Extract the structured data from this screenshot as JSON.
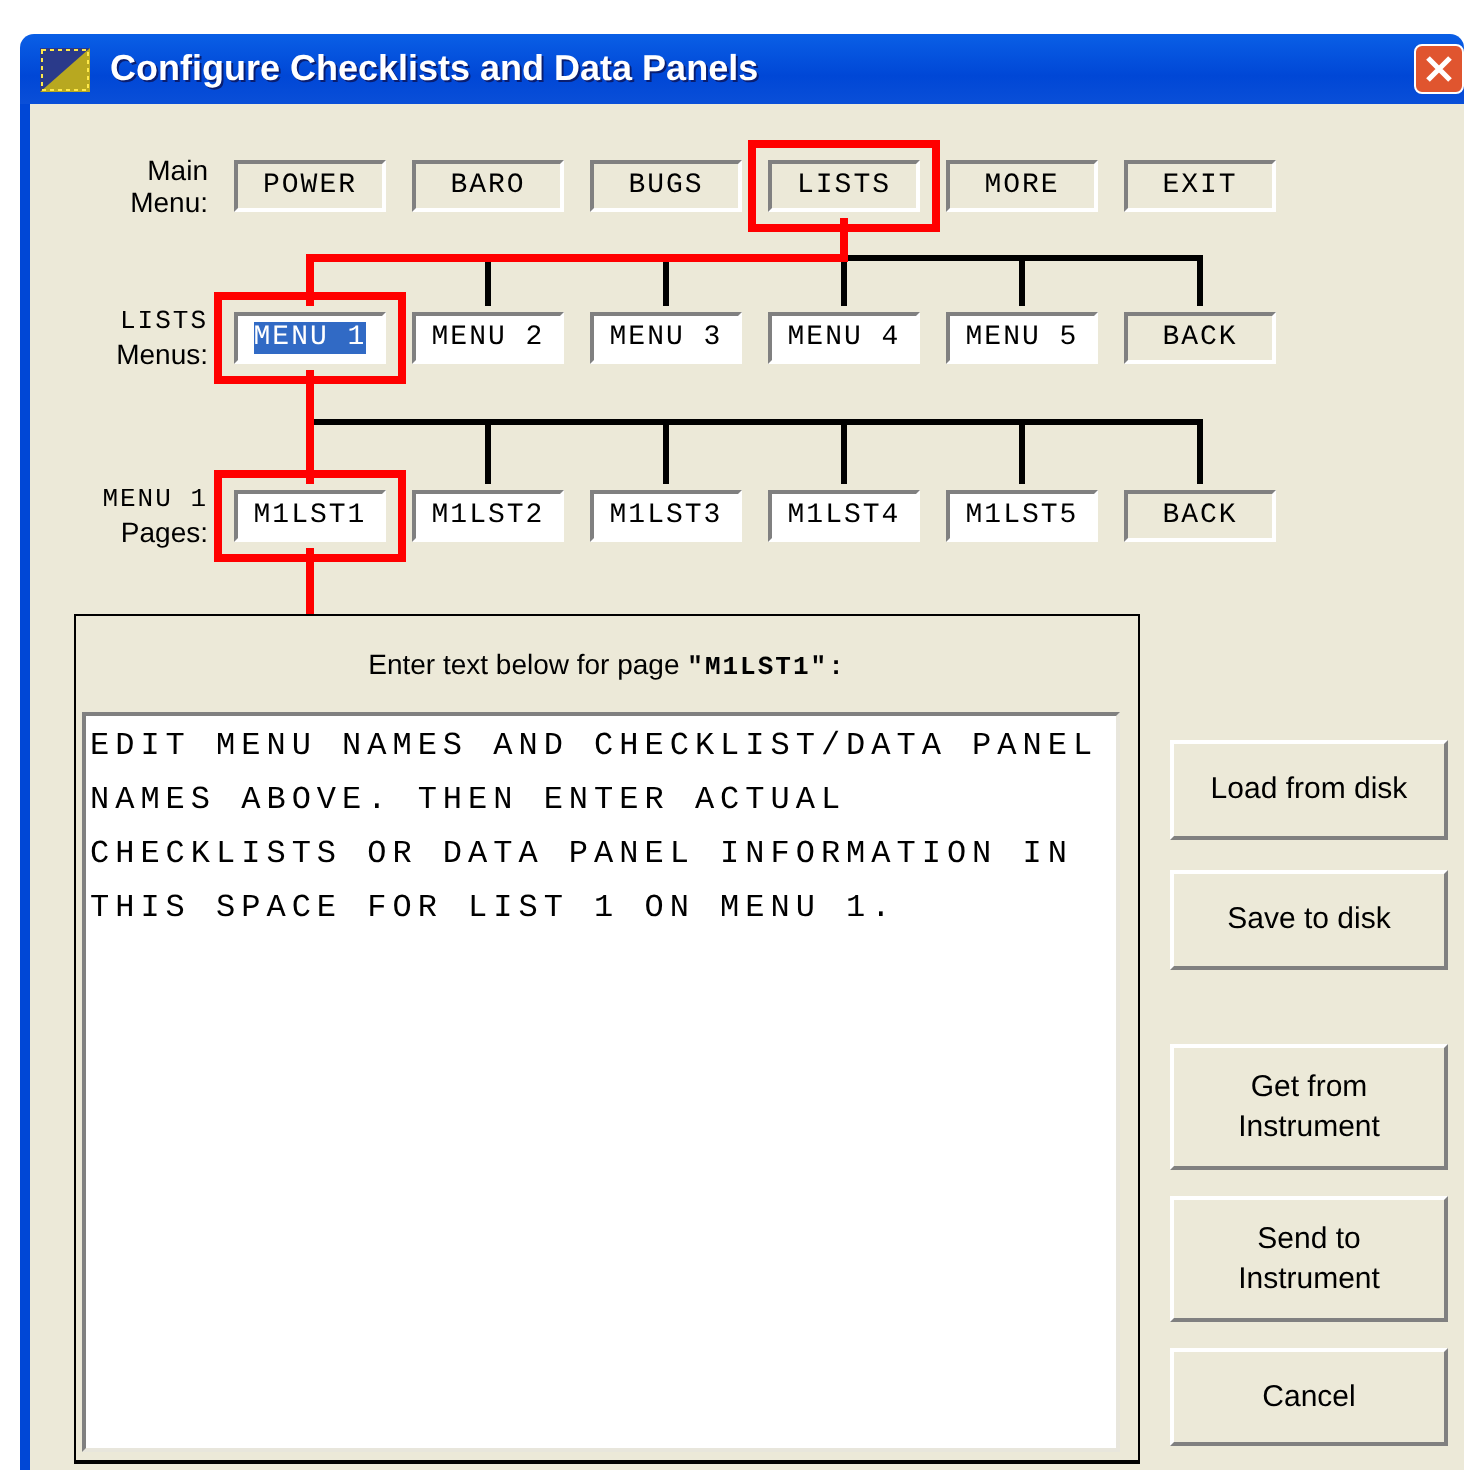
{
  "window": {
    "title": "Configure Checklists and Data Panels"
  },
  "tree_rows": [
    {
      "label_top": "Main",
      "label_bottom": "Menu:",
      "items": [
        {
          "kind": "button",
          "label": "POWER",
          "selected": false
        },
        {
          "kind": "button",
          "label": "BARO",
          "selected": false
        },
        {
          "kind": "button",
          "label": "BUGS",
          "selected": false
        },
        {
          "kind": "button",
          "label": "LISTS",
          "selected": true
        },
        {
          "kind": "button",
          "label": "MORE",
          "selected": false
        },
        {
          "kind": "button",
          "label": "EXIT",
          "selected": false
        }
      ]
    },
    {
      "label_top": "LISTS",
      "label_bottom": "Menus:",
      "items": [
        {
          "kind": "field",
          "label": "MENU 1",
          "selected": true,
          "text_selected": true
        },
        {
          "kind": "field",
          "label": "MENU 2",
          "selected": false,
          "text_selected": false
        },
        {
          "kind": "field",
          "label": "MENU 3",
          "selected": false,
          "text_selected": false
        },
        {
          "kind": "field",
          "label": "MENU 4",
          "selected": false,
          "text_selected": false
        },
        {
          "kind": "field",
          "label": "MENU 5",
          "selected": false,
          "text_selected": false
        },
        {
          "kind": "button",
          "label": "BACK",
          "selected": false
        }
      ]
    },
    {
      "label_top": "MENU 1",
      "label_bottom": "Pages:",
      "items": [
        {
          "kind": "field",
          "label": "M1LST1",
          "selected": true,
          "text_selected": false
        },
        {
          "kind": "field",
          "label": "M1LST2",
          "selected": false,
          "text_selected": false
        },
        {
          "kind": "field",
          "label": "M1LST3",
          "selected": false,
          "text_selected": false
        },
        {
          "kind": "field",
          "label": "M1LST4",
          "selected": false,
          "text_selected": false
        },
        {
          "kind": "field",
          "label": "M1LST5",
          "selected": false,
          "text_selected": false
        },
        {
          "kind": "button",
          "label": "BACK",
          "selected": false
        }
      ]
    }
  ],
  "editor": {
    "prompt": "Enter text below for page",
    "page_name": "\"M1LST1\":",
    "value": "EDIT MENU NAMES AND CHECKLIST/DATA PANEL NAMES ABOVE. THEN ENTER ACTUAL CHECKLISTS OR DATA PANEL INFORMATION IN THIS SPACE FOR LIST 1 ON MENU 1."
  },
  "file_buttons": [
    "Load from disk",
    "Save to disk"
  ],
  "instrument_buttons": [
    "Get from\nInstrument",
    "Send to\nInstrument",
    "Cancel"
  ]
}
